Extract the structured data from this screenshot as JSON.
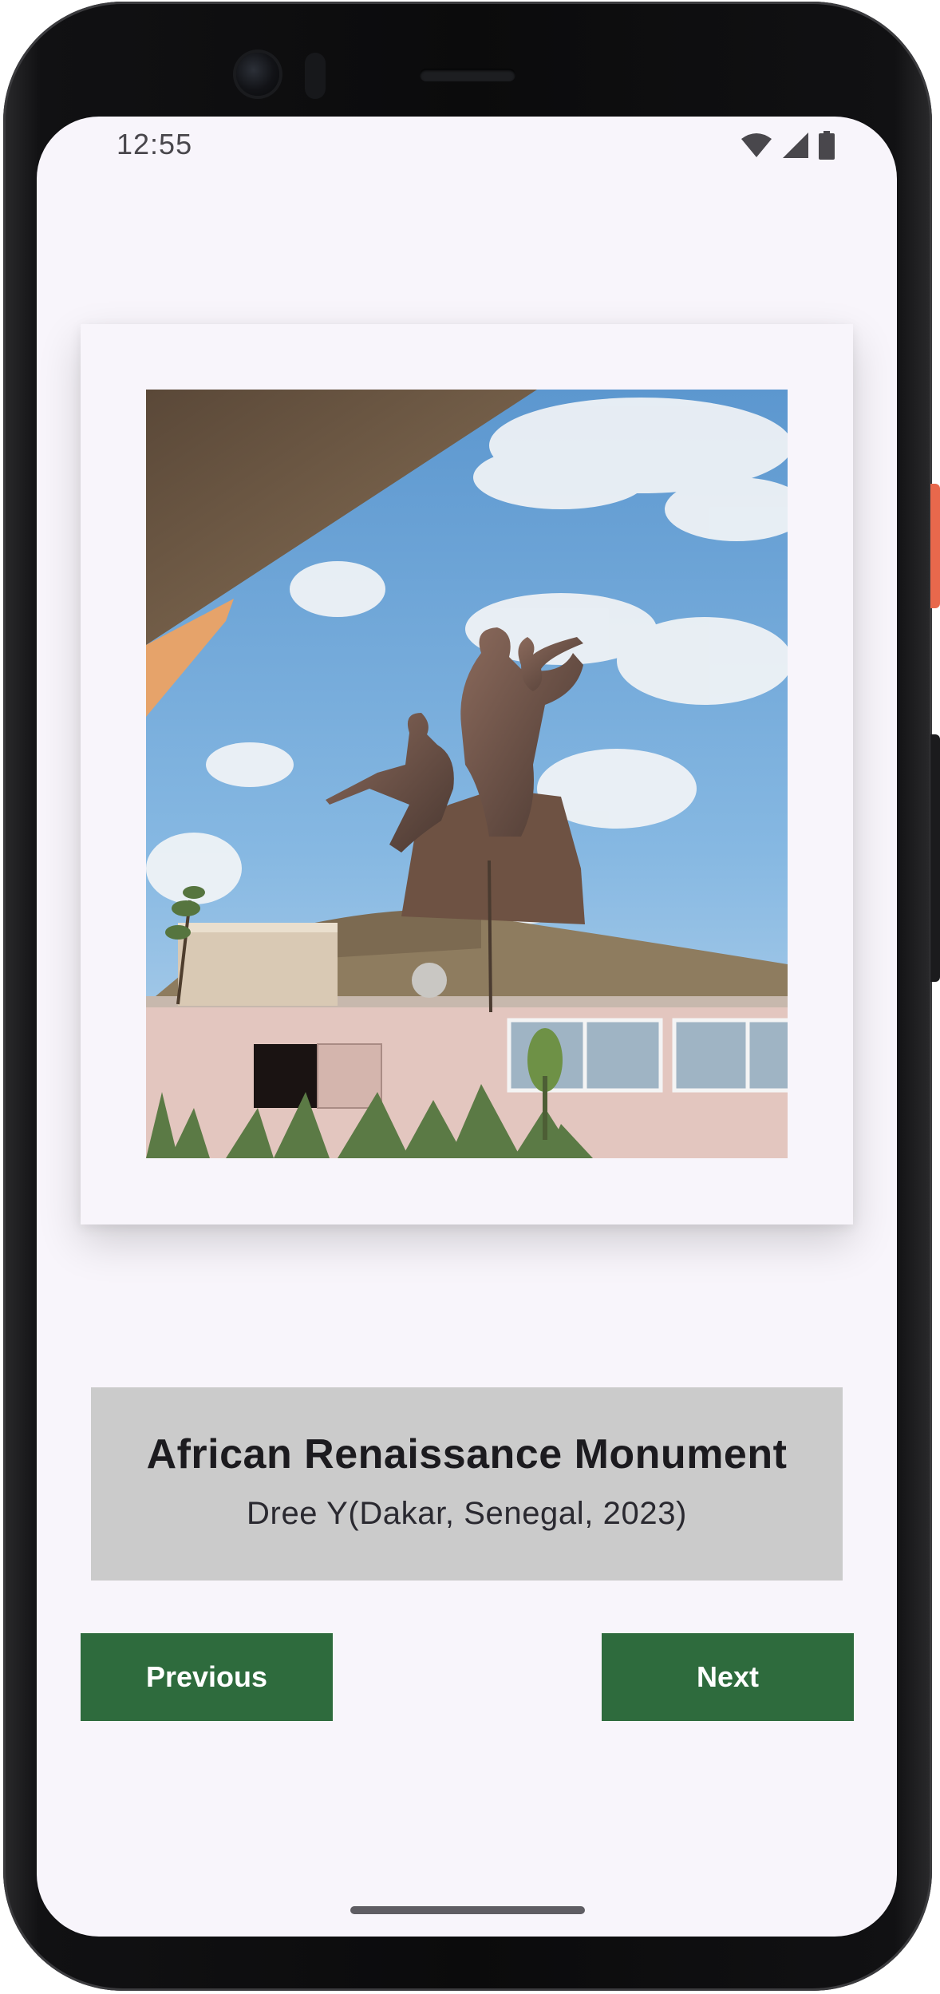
{
  "status_bar": {
    "time": "12:55",
    "icons": [
      "wifi-icon",
      "cellular-signal-icon",
      "battery-icon"
    ]
  },
  "artwork": {
    "image_description_icon": "statue-photo",
    "alt": "African Renaissance Monument"
  },
  "caption": {
    "title": "African Renaissance Monument",
    "subtitle": "Dree Y(Dakar, Senegal, 2023)"
  },
  "buttons": {
    "previous_label": "Previous",
    "next_label": "Next"
  },
  "colors": {
    "screen_background": "#f8f5fb",
    "caption_background": "#cbcbcb",
    "button_background": "#2e6b3d",
    "button_text": "#ffffff",
    "title_text": "#1c1b1f"
  }
}
